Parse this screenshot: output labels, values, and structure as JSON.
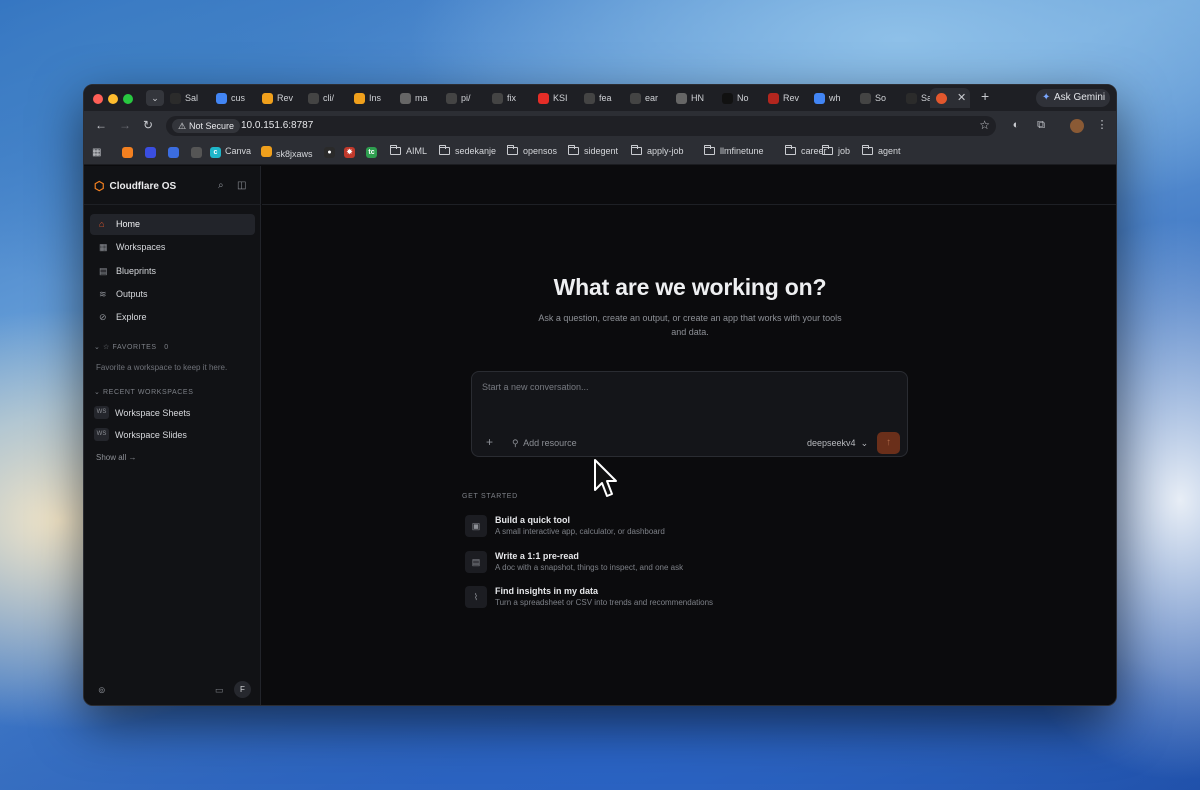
{
  "browser": {
    "tab_search_icon": "chevron-down-icon",
    "tabs": [
      {
        "label": "Sal",
        "icon": "tt",
        "color": "#2b2b2b"
      },
      {
        "label": "cus",
        "icon": "google",
        "color": "#4285f4"
      },
      {
        "label": "Rev",
        "icon": "cloud",
        "color": "#f0a01c"
      },
      {
        "label": "cli/",
        "icon": "github",
        "color": "#444444"
      },
      {
        "label": "Ins",
        "icon": "cloud",
        "color": "#f0a01c"
      },
      {
        "label": "ma",
        "icon": "globe",
        "color": "#666666"
      },
      {
        "label": "pi/",
        "icon": "github",
        "color": "#444444"
      },
      {
        "label": "fix",
        "icon": "github",
        "color": "#444444"
      },
      {
        "label": "KSI",
        "icon": "youtube",
        "color": "#e52d27"
      },
      {
        "label": "fea",
        "icon": "github",
        "color": "#444444"
      },
      {
        "label": "ear",
        "icon": "github",
        "color": "#444444"
      },
      {
        "label": "HN",
        "icon": "globe",
        "color": "#666666"
      },
      {
        "label": "No",
        "icon": "x",
        "color": "#111111"
      },
      {
        "label": "Rev",
        "icon": "record",
        "color": "#b3261e"
      },
      {
        "label": "wh",
        "icon": "google",
        "color": "#4285f4"
      },
      {
        "label": "So",
        "icon": "github",
        "color": "#444444"
      },
      {
        "label": "Sa",
        "icon": "tt",
        "color": "#2b2b2b"
      }
    ],
    "active_tab_icon": "cloudflare-icon",
    "ask_gemini": "Ask Gemini",
    "not_secure": "Not Secure",
    "url": "10.0.151.6:8787",
    "bookmarks": {
      "icons": [
        {
          "name": "cloud",
          "color": "#f38020"
        },
        {
          "name": "k",
          "color": "#3a4ee0"
        },
        {
          "name": "shield",
          "color": "#3b6de0"
        },
        {
          "name": "circle",
          "color": "#555555"
        }
      ],
      "canva": "Canva",
      "sk8jxaws": "sk8jxaws",
      "folders": [
        "AIML",
        "sedekanje",
        "opensos",
        "sidegent",
        "apply-job",
        "llmfinetune",
        "career",
        "job",
        "agent"
      ]
    }
  },
  "app": {
    "brand": "Cloudflare OS",
    "nav": [
      {
        "label": "Home",
        "icon": "home-icon",
        "active": true
      },
      {
        "label": "Workspaces",
        "icon": "grid-icon",
        "active": false
      },
      {
        "label": "Blueprints",
        "icon": "layout-icon",
        "active": false
      },
      {
        "label": "Outputs",
        "icon": "layers-icon",
        "active": false
      },
      {
        "label": "Explore",
        "icon": "compass-icon",
        "active": false
      }
    ],
    "favorites_label": "FAVORITES",
    "favorites_count": "0",
    "favorites_empty": "Favorite a workspace to keep it here.",
    "recent_label": "RECENT WORKSPACES",
    "recent": [
      {
        "badge": "WS",
        "label": "Workspace Sheets"
      },
      {
        "badge": "WS",
        "label": "Workspace Slides"
      }
    ],
    "show_all": "Show all →",
    "user_initial": "F"
  },
  "main": {
    "title": "What are we working on?",
    "subtitle": "Ask a question, create an output, or create an app that works with your tools and data.",
    "composer": {
      "placeholder": "Start a new conversation...",
      "add_resource": "Add resource",
      "model": "deepseekv4"
    },
    "get_started_label": "GET STARTED",
    "get_started": [
      {
        "title": "Build a quick tool",
        "desc": "A small interactive app, calculator, or dashboard",
        "icon": "app-window-icon"
      },
      {
        "title": "Write a 1:1 pre-read",
        "desc": "A doc with a snapshot, things to inspect, and one ask",
        "icon": "document-icon"
      },
      {
        "title": "Find insights in my data",
        "desc": "Turn a spreadsheet or CSV into trends and recommendations",
        "icon": "chart-icon"
      }
    ]
  }
}
